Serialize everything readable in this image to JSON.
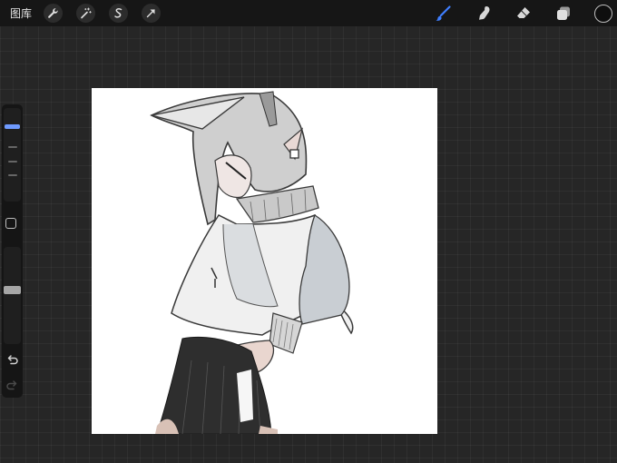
{
  "app": {
    "gallery_label": "图库"
  },
  "toolbar_left": [
    "wrench-icon",
    "magic-wand-icon",
    "selection-icon",
    "transform-arrow-icon"
  ],
  "toolbar_right": [
    "brush-icon",
    "smudge-icon",
    "eraser-icon",
    "layers-icon"
  ],
  "colors": {
    "brush_active": "#3f7fff",
    "current_color": "#0e0e0e",
    "background": "#262626",
    "canvas": "#ffffff"
  },
  "sidebar": {
    "brush_size_level": 0.82,
    "opacity_level": 0.5
  }
}
